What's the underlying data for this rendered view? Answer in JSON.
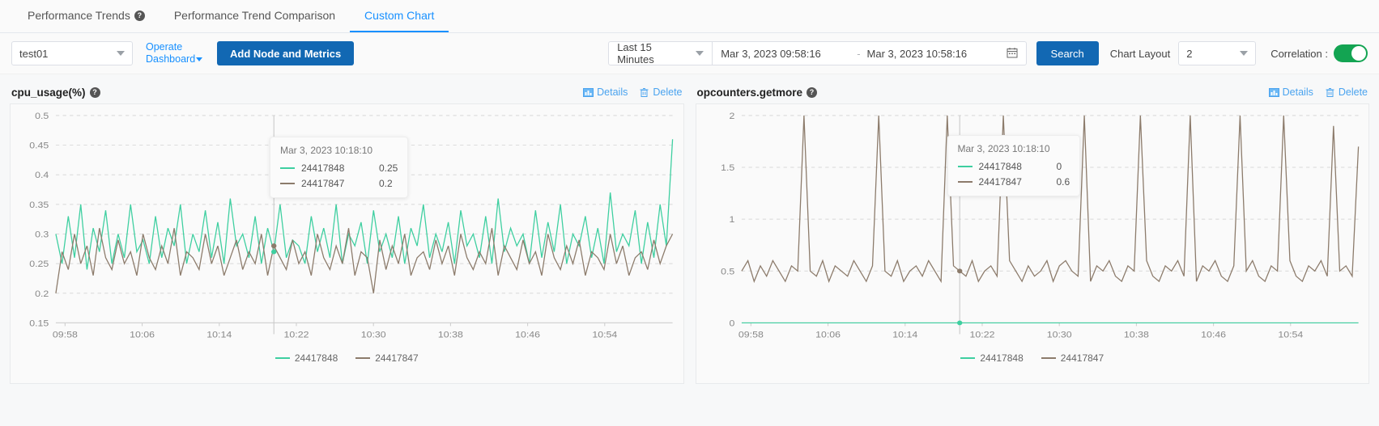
{
  "tabs": [
    {
      "label": "Performance Trends",
      "help": true,
      "active": false
    },
    {
      "label": "Performance Trend Comparison",
      "help": false,
      "active": false
    },
    {
      "label": "Custom Chart",
      "help": false,
      "active": true
    }
  ],
  "toolbar": {
    "node_select_value": "test01",
    "operate_line1": "Operate",
    "operate_line2": "Dashboard",
    "add_button": "Add Node and Metrics",
    "range_preset": "Last 15 Minutes",
    "start_date": "Mar 3, 2023 09:58:16",
    "date_separator": "-",
    "end_date": "Mar 3, 2023 10:58:16",
    "calendar_icon": "calendar-icon",
    "search_button": "Search",
    "chart_layout_label": "Chart Layout",
    "chart_layout_value": "2",
    "correlation_label": "Correlation :",
    "correlation_on": true
  },
  "colors": {
    "accent_blue": "#1268b3",
    "link_blue": "#4aa3ef",
    "tab_active": "#1890ff",
    "series_green": "#3ecfa0",
    "series_brown": "#8c7b6b",
    "toggle_green": "#13a452"
  },
  "panels": [
    {
      "title": "cpu_usage(%)",
      "details_label": "Details",
      "delete_label": "Delete",
      "tooltip": {
        "time": "Mar 3, 2023 10:18:10",
        "rows": [
          {
            "name": "24417848",
            "value": "0.25",
            "color": "#3ecfa0"
          },
          {
            "name": "24417847",
            "value": "0.2",
            "color": "#8c7b6b"
          }
        ]
      },
      "legend": [
        {
          "name": "24417848",
          "color": "#3ecfa0"
        },
        {
          "name": "24417847",
          "color": "#8c7b6b"
        }
      ]
    },
    {
      "title": "opcounters.getmore",
      "details_label": "Details",
      "delete_label": "Delete",
      "tooltip": {
        "time": "Mar 3, 2023 10:18:10",
        "rows": [
          {
            "name": "24417848",
            "value": "0",
            "color": "#3ecfa0"
          },
          {
            "name": "24417847",
            "value": "0.6",
            "color": "#8c7b6b"
          }
        ]
      },
      "legend": [
        {
          "name": "24417848",
          "color": "#3ecfa0"
        },
        {
          "name": "24417847",
          "color": "#8c7b6b"
        }
      ]
    }
  ],
  "chart_data": [
    {
      "type": "line",
      "title": "cpu_usage(%)",
      "xlabel": "",
      "ylabel": "",
      "ylim": [
        0.15,
        0.5
      ],
      "yticks": [
        0.5,
        0.45,
        0.4,
        0.35,
        0.3,
        0.25,
        0.2,
        0.15
      ],
      "xticks": [
        "09:58",
        "10:06",
        "10:14",
        "10:22",
        "10:30",
        "10:38",
        "10:46",
        "10:54"
      ],
      "grid": true,
      "legend_position": "bottom",
      "cursor_x_label": "Mar 3, 2023 10:18:10",
      "series": [
        {
          "name": "24417848",
          "color": "#3ecfa0",
          "values": [
            0.3,
            0.25,
            0.33,
            0.26,
            0.35,
            0.24,
            0.31,
            0.27,
            0.34,
            0.25,
            0.3,
            0.26,
            0.35,
            0.27,
            0.29,
            0.25,
            0.33,
            0.26,
            0.31,
            0.28,
            0.35,
            0.25,
            0.3,
            0.27,
            0.34,
            0.26,
            0.32,
            0.25,
            0.36,
            0.28,
            0.3,
            0.26,
            0.33,
            0.25,
            0.31,
            0.27,
            0.35,
            0.26,
            0.29,
            0.28,
            0.25,
            0.33,
            0.27,
            0.31,
            0.26,
            0.35,
            0.25,
            0.3,
            0.28,
            0.32,
            0.25,
            0.34,
            0.27,
            0.3,
            0.26,
            0.33,
            0.25,
            0.31,
            0.28,
            0.35,
            0.26,
            0.3,
            0.27,
            0.32,
            0.25,
            0.34,
            0.28,
            0.3,
            0.26,
            0.33,
            0.25,
            0.36,
            0.27,
            0.31,
            0.28,
            0.3,
            0.25,
            0.34,
            0.26,
            0.32,
            0.27,
            0.35,
            0.25,
            0.3,
            0.28,
            0.33,
            0.26,
            0.31,
            0.25,
            0.37,
            0.27,
            0.3,
            0.28,
            0.34,
            0.25,
            0.32,
            0.26,
            0.35,
            0.28,
            0.46
          ]
        },
        {
          "name": "24417847",
          "color": "#8c7b6b",
          "values": [
            0.2,
            0.27,
            0.24,
            0.3,
            0.25,
            0.28,
            0.23,
            0.31,
            0.26,
            0.24,
            0.29,
            0.25,
            0.27,
            0.23,
            0.3,
            0.26,
            0.24,
            0.28,
            0.25,
            0.31,
            0.23,
            0.27,
            0.26,
            0.24,
            0.3,
            0.25,
            0.28,
            0.23,
            0.26,
            0.29,
            0.24,
            0.27,
            0.25,
            0.3,
            0.23,
            0.28,
            0.26,
            0.24,
            0.29,
            0.25,
            0.27,
            0.23,
            0.3,
            0.26,
            0.24,
            0.28,
            0.25,
            0.31,
            0.23,
            0.27,
            0.26,
            0.2,
            0.29,
            0.24,
            0.28,
            0.25,
            0.3,
            0.23,
            0.26,
            0.27,
            0.24,
            0.29,
            0.25,
            0.28,
            0.23,
            0.3,
            0.26,
            0.24,
            0.27,
            0.25,
            0.31,
            0.23,
            0.28,
            0.26,
            0.24,
            0.29,
            0.25,
            0.27,
            0.23,
            0.3,
            0.26,
            0.24,
            0.28,
            0.25,
            0.29,
            0.23,
            0.27,
            0.26,
            0.24,
            0.3,
            0.25,
            0.28,
            0.23,
            0.26,
            0.27,
            0.24,
            0.29,
            0.25,
            0.28,
            0.3
          ]
        }
      ]
    },
    {
      "type": "line",
      "title": "opcounters.getmore",
      "xlabel": "",
      "ylabel": "",
      "ylim": [
        0,
        2
      ],
      "yticks": [
        2,
        1.5,
        1,
        0.5,
        0
      ],
      "xticks": [
        "09:58",
        "10:06",
        "10:14",
        "10:22",
        "10:30",
        "10:38",
        "10:46",
        "10:54"
      ],
      "grid": true,
      "legend_position": "bottom",
      "cursor_x_label": "Mar 3, 2023 10:18:10",
      "series": [
        {
          "name": "24417848",
          "color": "#3ecfa0",
          "values": [
            0,
            0,
            0,
            0,
            0,
            0,
            0,
            0,
            0,
            0,
            0,
            0,
            0,
            0,
            0,
            0,
            0,
            0,
            0,
            0,
            0,
            0,
            0,
            0,
            0,
            0,
            0,
            0,
            0,
            0,
            0,
            0,
            0,
            0,
            0,
            0,
            0,
            0,
            0,
            0,
            0,
            0,
            0,
            0,
            0,
            0,
            0,
            0,
            0,
            0,
            0,
            0,
            0,
            0,
            0,
            0,
            0,
            0,
            0,
            0,
            0,
            0,
            0,
            0,
            0,
            0,
            0,
            0,
            0,
            0,
            0,
            0,
            0,
            0,
            0,
            0,
            0,
            0,
            0,
            0,
            0,
            0,
            0,
            0,
            0,
            0,
            0,
            0,
            0,
            0,
            0,
            0,
            0,
            0,
            0,
            0,
            0,
            0,
            0,
            0
          ]
        },
        {
          "name": "24417847",
          "color": "#8c7b6b",
          "values": [
            0.5,
            0.6,
            0.4,
            0.55,
            0.45,
            0.6,
            0.5,
            0.4,
            0.55,
            0.5,
            2,
            0.5,
            0.45,
            0.6,
            0.4,
            0.55,
            0.5,
            0.45,
            0.6,
            0.5,
            0.4,
            0.55,
            2,
            0.5,
            0.45,
            0.6,
            0.4,
            0.5,
            0.55,
            0.45,
            0.6,
            0.5,
            0.4,
            2,
            0.55,
            0.5,
            0.45,
            0.6,
            0.4,
            0.5,
            0.55,
            0.45,
            2,
            0.6,
            0.5,
            0.4,
            0.55,
            0.45,
            0.5,
            0.6,
            0.4,
            0.55,
            0.6,
            0.5,
            0.45,
            2,
            0.4,
            0.55,
            0.5,
            0.6,
            0.45,
            0.4,
            0.55,
            0.5,
            2,
            0.6,
            0.45,
            0.4,
            0.55,
            0.5,
            0.6,
            0.45,
            2,
            0.4,
            0.55,
            0.5,
            0.6,
            0.45,
            0.4,
            0.55,
            2,
            0.5,
            0.6,
            0.45,
            0.4,
            0.55,
            0.5,
            2,
            0.6,
            0.45,
            0.4,
            0.55,
            0.5,
            0.6,
            0.45,
            1.9,
            0.5,
            0.55,
            0.45,
            1.7
          ]
        }
      ]
    }
  ]
}
